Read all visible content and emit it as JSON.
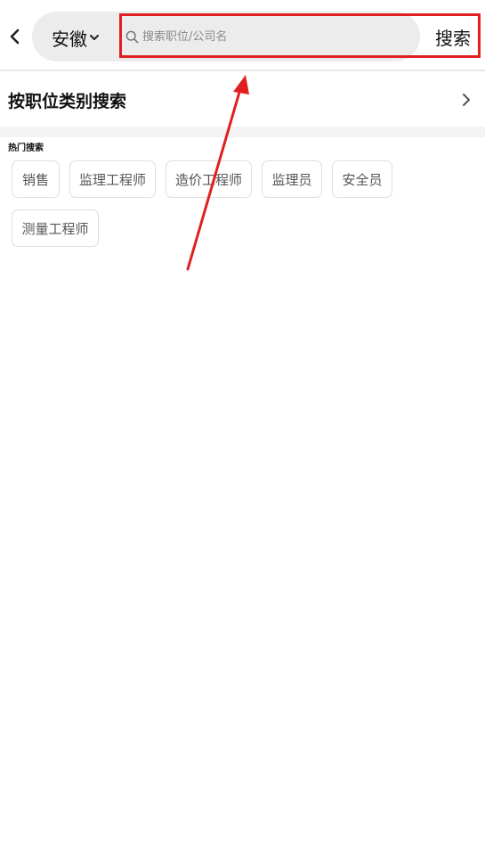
{
  "header": {
    "city": "安徽",
    "search_placeholder": "搜索职位/公司名",
    "search_button": "搜索"
  },
  "category": {
    "title": "按职位类别搜索"
  },
  "hot": {
    "label": "热门搜索",
    "tags": [
      "销售",
      "监理工程师",
      "造价工程师",
      "监理员",
      "安全员",
      "测量工程师"
    ]
  },
  "colors": {
    "highlight": "#e02020",
    "pill_bg": "#ececec"
  }
}
